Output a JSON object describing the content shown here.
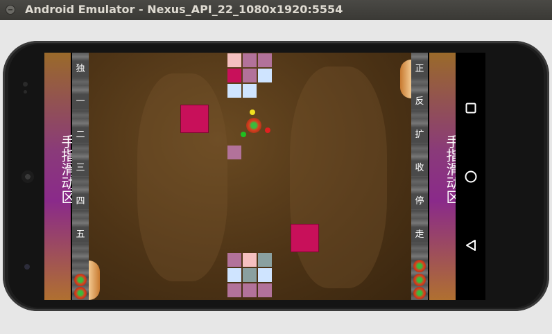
{
  "window": {
    "title": "Android Emulator - Nexus_API_22_1080x1920:5554"
  },
  "left_strip": {
    "label": "手指滑动区"
  },
  "right_strip": {
    "label": "手指滑动区"
  },
  "left_buttons": [
    "独",
    "一",
    "二",
    "三",
    "四",
    "五"
  ],
  "right_buttons": [
    "正",
    "反",
    "扩",
    "收",
    "停",
    "走"
  ],
  "colors": {
    "brick_pink": "#f5c0c0",
    "brick_mauve": "#b2729a",
    "brick_magenta": "#c8105a",
    "brick_light_blue": "#cfe4ff",
    "brick_gray": "#8aa0a0",
    "power_block": "#c8105a"
  },
  "icons": {
    "nav_square": "square-icon",
    "nav_circle": "circle-icon",
    "nav_triangle": "back-triangle-icon"
  }
}
